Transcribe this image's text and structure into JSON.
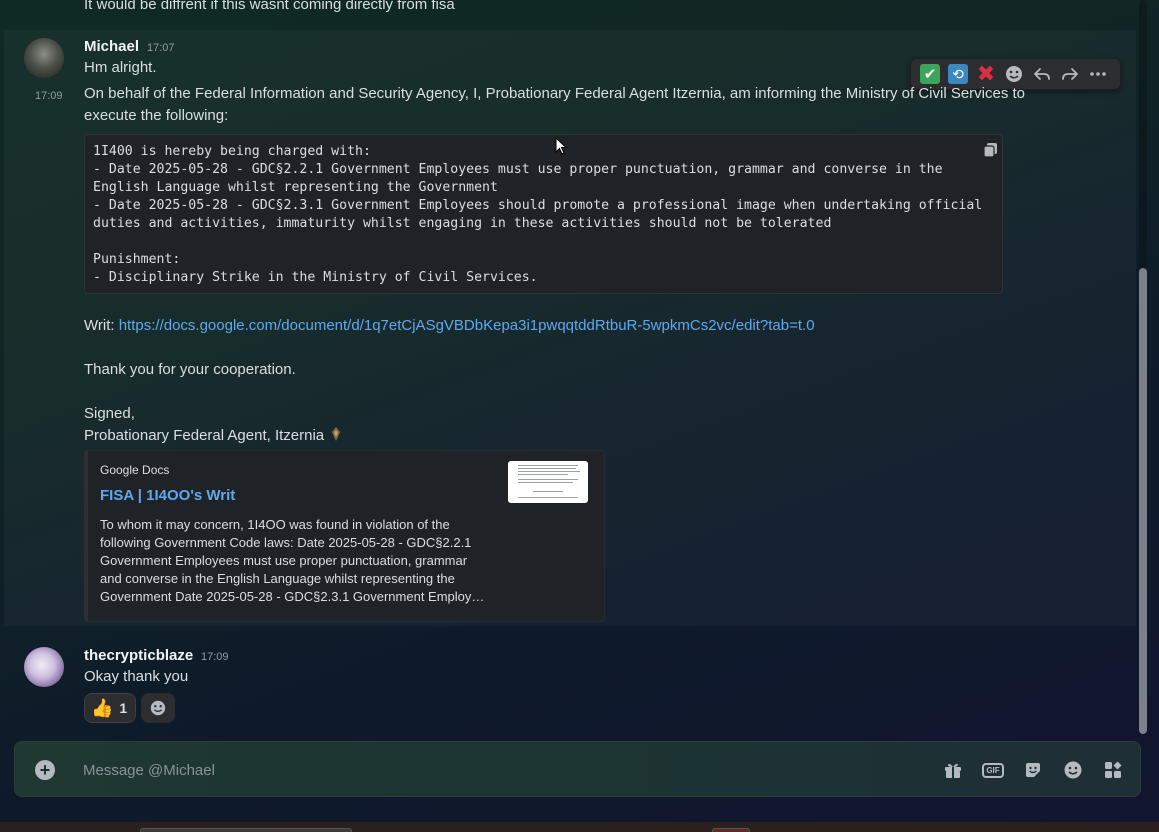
{
  "previous_message": "It would be diffrent if this wasnt coming directly from fisa",
  "messages": [
    {
      "author": "Michael",
      "timestamp": "17:07",
      "text": "Hm alright."
    },
    {
      "side_timestamp": "17:09",
      "intro": "On behalf of the Federal Information and Security Agency, I, Probationary Federal Agent Itzernia, am informing the Ministry of Civil Services to execute the following:",
      "code": "1I400 is hereby being charged with:\n- Date 2025-05-28 - GDC§2.2.1 Government Employees must use proper punctuation, grammar and converse in the English Language whilst representing the Government\n- Date 2025-05-28 - GDC§2.3.1 Government Employees should promote a professional image when undertaking official duties and activities, immaturity whilst engaging in these activities should not be tolerated\n\nPunishment:\n- Disciplinary Strike in the Ministry of Civil Services.",
      "writ_label": "Writ: ",
      "writ_url": "https://docs.google.com/document/d/1q7etCjASgVBDbKepa3i1pwqqtddRtbuR-5wpkmCs2vc/edit?tab=t.0",
      "thanks": "Thank you for your cooperation.",
      "signed": "Signed,",
      "signature": "Probationary Federal Agent, Itzernia",
      "embed": {
        "provider": "Google Docs",
        "title": "FISA | 1I4OO's Writ",
        "description": "To whom it may concern, 1I4OO was found in violation of the following Government Code laws: Date 2025-05-28 - GDC§2.2.1 Government Employees must use proper punctuation, grammar and converse in the English Language whilst representing the Government Date 2025-05-28 - GDC§2.3.1 Government Employ…"
      }
    },
    {
      "author": "thecrypticblaze",
      "timestamp": "17:09",
      "text": "Okay thank you",
      "reaction": {
        "emoji": "👍",
        "count": "1"
      }
    }
  ],
  "toolbar": {
    "icons": [
      "check-icon",
      "repeat-icon",
      "x-icon",
      "add-reaction-icon",
      "reply-icon",
      "forward-icon",
      "more-icon"
    ]
  },
  "composer": {
    "placeholder": "Message @Michael",
    "gif_label": "GIF"
  },
  "colors": {
    "link": "#5fa8f0",
    "check": "#3ba55c",
    "repeat": "#3b88c3",
    "x": "#dd2e44"
  }
}
